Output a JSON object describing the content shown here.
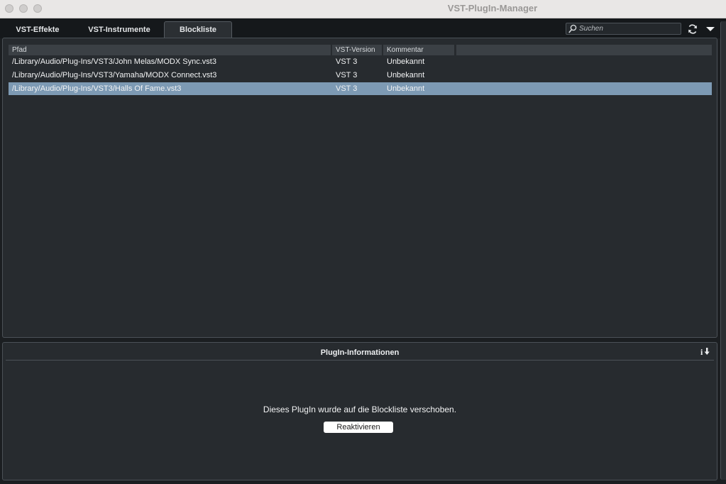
{
  "window": {
    "title": "VST-PlugIn-Manager"
  },
  "tabs": [
    {
      "label": "VST-Effekte"
    },
    {
      "label": "VST-Instrumente"
    },
    {
      "label": "Blockliste"
    }
  ],
  "search": {
    "placeholder": "Suchen",
    "value": ""
  },
  "table": {
    "columns": [
      "Pfad",
      "VST-Version",
      "Kommentar",
      ""
    ],
    "rows": [
      {
        "path": "/Library/Audio/Plug-Ins/VST3/John Melas/MODX Sync.vst3",
        "version": "VST 3",
        "comment": "Unbekannt",
        "selected": false
      },
      {
        "path": "/Library/Audio/Plug-Ins/VST3/Yamaha/MODX Connect.vst3",
        "version": "VST 3",
        "comment": "Unbekannt",
        "selected": false
      },
      {
        "path": "/Library/Audio/Plug-Ins/VST3/Halls Of Fame.vst3",
        "version": "VST 3",
        "comment": "Unbekannt",
        "selected": true
      }
    ]
  },
  "info_panel": {
    "title": "PlugIn-Informationen",
    "message": "Dieses PlugIn wurde auf die Blockliste verschoben.",
    "reactivate_label": "Reaktivieren"
  },
  "icons": {
    "search": "search-icon",
    "refresh": "refresh-icon",
    "menu": "dropdown-arrow-icon",
    "info_export": "info-export-icon"
  },
  "colors": {
    "background": "#1b1e21",
    "panel": "#272b2f",
    "selection": "#7d9ab4",
    "header": "#3b4045"
  }
}
